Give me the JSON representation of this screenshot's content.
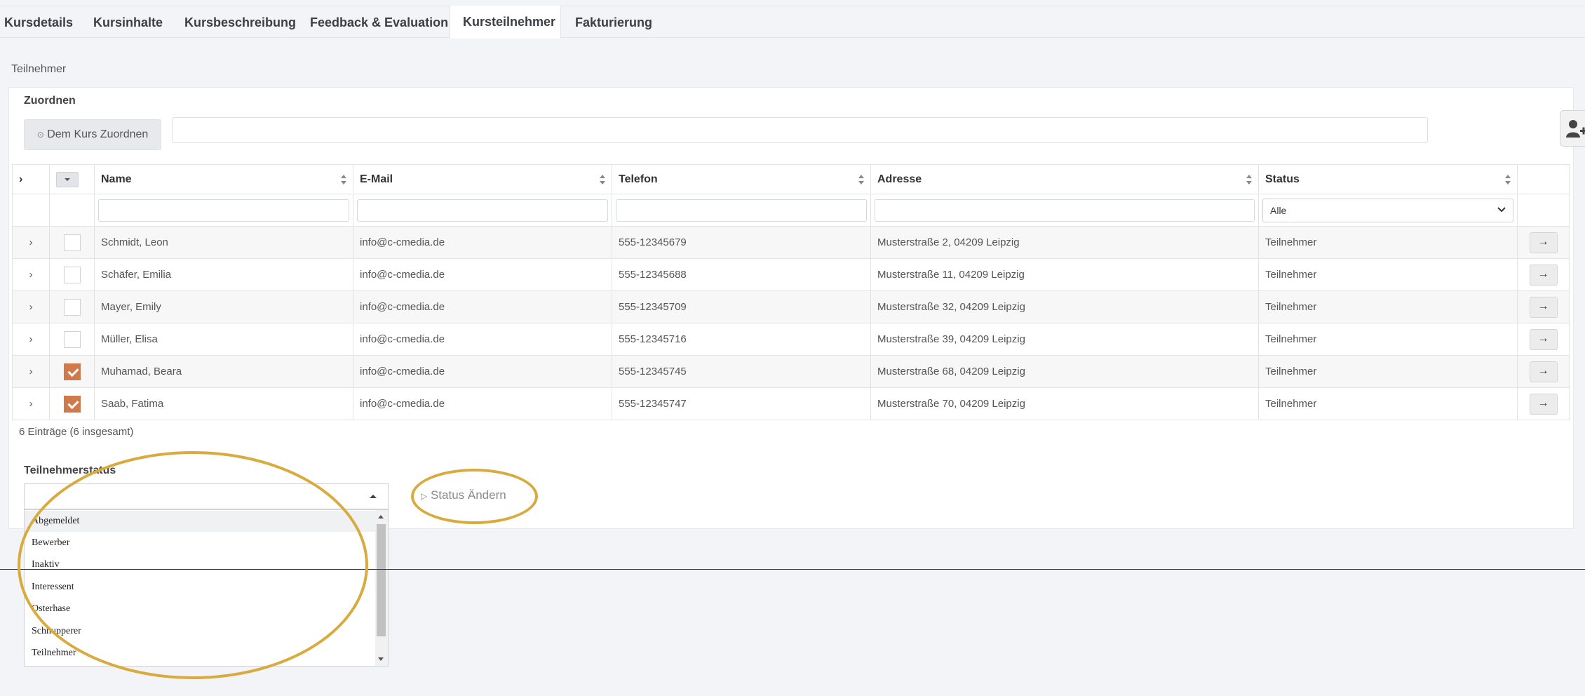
{
  "tabs": [
    {
      "label": "Kursdetails",
      "active": false
    },
    {
      "label": "Kursinhalte",
      "active": false
    },
    {
      "label": "Kursbeschreibung",
      "active": false
    },
    {
      "label": "Feedback & Evaluation",
      "active": false
    },
    {
      "label": "Kursteilnehmer",
      "active": true
    },
    {
      "label": "Fakturierung",
      "active": false
    }
  ],
  "section_label": "Teilnehmer",
  "assign": {
    "title": "Zuordnen",
    "button_label": "Dem Kurs Zuordnen",
    "input_value": ""
  },
  "table": {
    "columns": [
      "Name",
      "E-Mail",
      "Telefon",
      "Adresse",
      "Status"
    ],
    "status_filter": "Alle",
    "rows": [
      {
        "name": "Schmidt, Leon",
        "email": "info@c-cmedia.de",
        "phone": "555-12345679",
        "address": "Musterstraße 2, 04209 Leipzig",
        "status": "Teilnehmer",
        "checked": false
      },
      {
        "name": "Schäfer, Emilia",
        "email": "info@c-cmedia.de",
        "phone": "555-12345688",
        "address": "Musterstraße 11, 04209 Leipzig",
        "status": "Teilnehmer",
        "checked": false
      },
      {
        "name": "Mayer, Emily",
        "email": "info@c-cmedia.de",
        "phone": "555-12345709",
        "address": "Musterstraße 32, 04209 Leipzig",
        "status": "Teilnehmer",
        "checked": false
      },
      {
        "name": "Müller, Elisa",
        "email": "info@c-cmedia.de",
        "phone": "555-12345716",
        "address": "Musterstraße 39, 04209 Leipzig",
        "status": "Teilnehmer",
        "checked": false
      },
      {
        "name": "Muhamad, Beara",
        "email": "info@c-cmedia.de",
        "phone": "555-12345745",
        "address": "Musterstraße 68, 04209 Leipzig",
        "status": "Teilnehmer",
        "checked": true
      },
      {
        "name": "Saab, Fatima",
        "email": "info@c-cmedia.de",
        "phone": "555-12345747",
        "address": "Musterstraße 70, 04209 Leipzig",
        "status": "Teilnehmer",
        "checked": true
      }
    ],
    "count_text": "6 Einträge (6 insgesamt)"
  },
  "participant_status": {
    "label": "Teilnehmerstatus",
    "selected": "",
    "options": [
      "Abgemeldet",
      "Bewerber",
      "Inaktiv",
      "Interessent",
      "Osterhase",
      "Schnupperer",
      "Teilnehmer"
    ],
    "highlighted": "Abgemeldet"
  },
  "status_button_label": "Status Ändern",
  "colors": {
    "accent": "#d07a4c",
    "annotation": "#d9aa3e"
  }
}
